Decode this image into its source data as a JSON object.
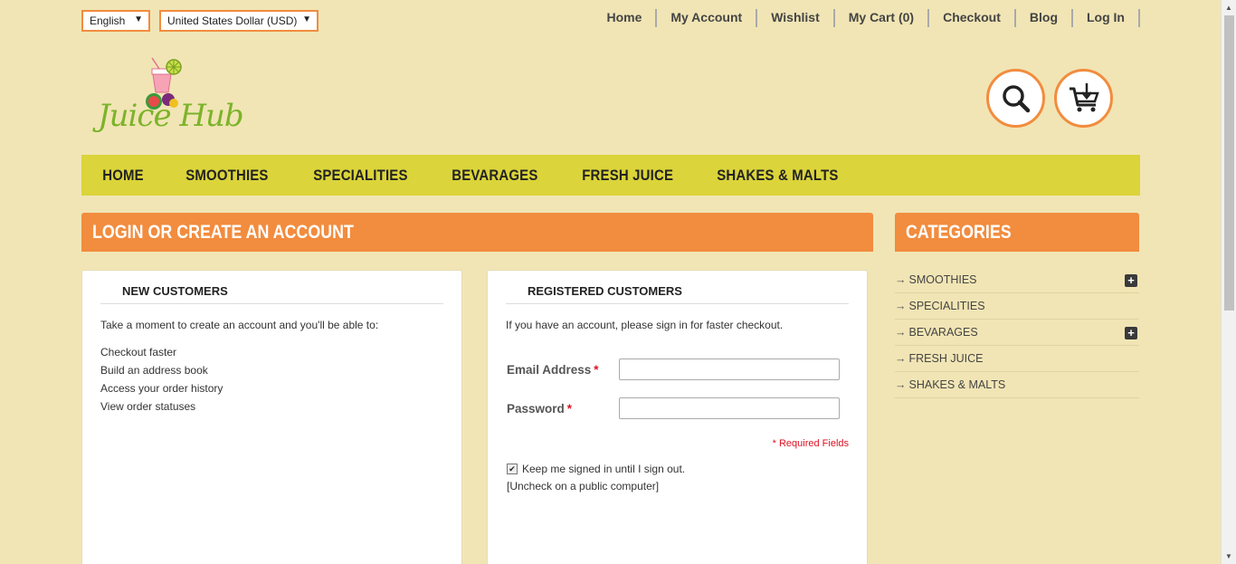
{
  "header": {
    "language": "English",
    "currency": "United States Dollar (USD)",
    "top_links": [
      "Home",
      "My Account",
      "Wishlist",
      "My Cart (0)",
      "Checkout",
      "Blog",
      "Log In"
    ]
  },
  "logo": {
    "text": "Juice Hub"
  },
  "nav": [
    "HOME",
    "SMOOTHIES",
    "SPECIALITIES",
    "BEVARAGES",
    "FRESH JUICE",
    "SHAKES & MALTS"
  ],
  "login": {
    "banner": "LOGIN OR CREATE AN ACCOUNT",
    "new_customers": {
      "title": "NEW CUSTOMERS",
      "intro": "Take a moment to create an account and you'll be able to:",
      "benefits": [
        "Checkout faster",
        "Build an address book",
        "Access your order history",
        "View order statuses"
      ]
    },
    "registered": {
      "title": "REGISTERED CUSTOMERS",
      "intro": "If you have an account, please sign in for faster checkout.",
      "email_label": "Email Address",
      "password_label": "Password",
      "required_mark": "*",
      "required_note": "* Required Fields",
      "keep_signed": "Keep me signed in until I sign out.",
      "uncheck_note": "[Uncheck on a public computer]"
    }
  },
  "categories": {
    "title": "CATEGORIES",
    "items": [
      "SMOOTHIES",
      "SPECIALITIES",
      "BEVARAGES",
      "FRESH JUICE",
      "SHAKES & MALTS"
    ],
    "arrow": "→",
    "expand": "+"
  },
  "colors": {
    "background": "#f1e5b5",
    "accent": "#f28c3e",
    "nav": "#dbd43a"
  }
}
